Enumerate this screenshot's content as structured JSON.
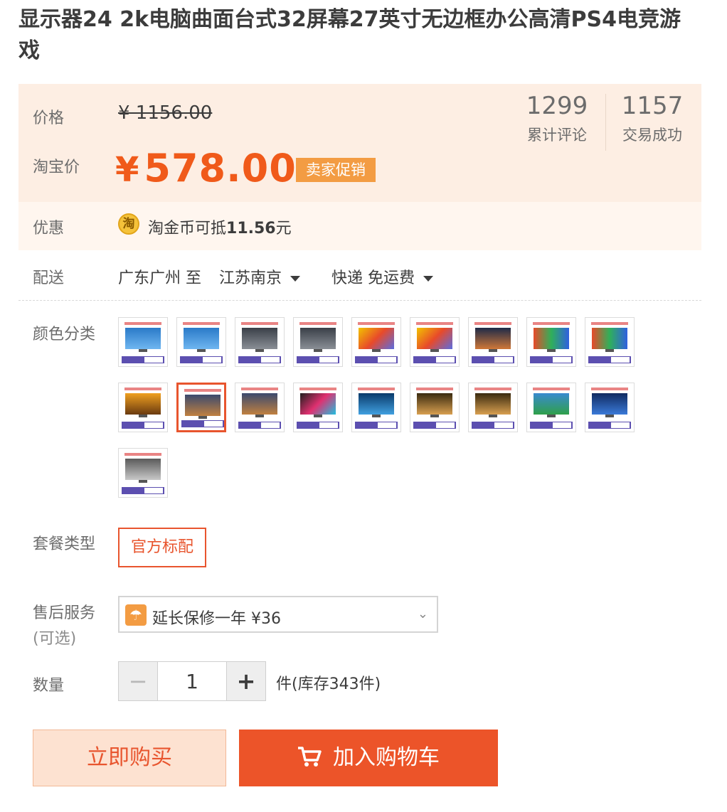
{
  "product": {
    "title": "显示器24 2k电脑曲面台式32屏幕27英寸无边框办公高清PS4电竞游戏"
  },
  "price": {
    "label": "价格",
    "original": "¥ 1156.00",
    "taobao_label": "淘宝价",
    "yen": "¥",
    "current": "578.00",
    "promo_tag": "卖家促销"
  },
  "stats": [
    {
      "value": "1299",
      "caption": "累计评论"
    },
    {
      "value": "1157",
      "caption": "交易成功"
    }
  ],
  "discount": {
    "label": "优惠",
    "coin_icon_char": "淘",
    "text_prefix": "淘金币可抵",
    "amount": "11.56",
    "text_suffix": "元"
  },
  "shipping": {
    "label": "配送",
    "from": "广东广州 至",
    "to": "江苏南京",
    "method": "快递 免运费"
  },
  "color": {
    "label": "颜色分类",
    "selected_index": 10
  },
  "package": {
    "label": "套餐类型",
    "option": "官方标配"
  },
  "service": {
    "label": "售后服务",
    "label_note": "(可选)",
    "option": "延长保修一年 ¥36"
  },
  "quantity": {
    "label": "数量",
    "minus": "−",
    "plus": "+",
    "value": "1",
    "stock": "件(库存343件)"
  },
  "actions": {
    "buy_now": "立即购买",
    "add_cart": "加入购物车"
  },
  "colors": {
    "accent": "#ec5429",
    "price_bg": "#fdeee3",
    "promo_tag": "#f39c43"
  }
}
